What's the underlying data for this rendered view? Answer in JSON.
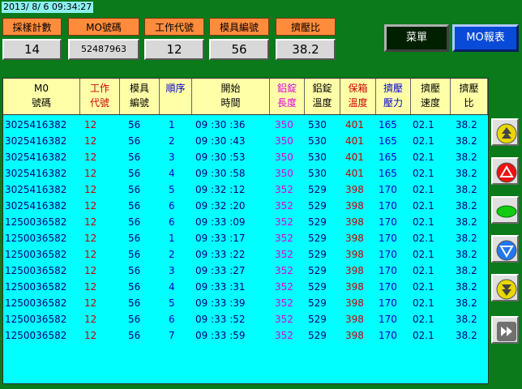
{
  "datetime": "2013/ 8/ 6 09:34:27",
  "stats": [
    {
      "label": "採樣計數",
      "value": "14"
    },
    {
      "label": "MO號碼",
      "value": "52487963"
    },
    {
      "label": "工作代號",
      "value": "12"
    },
    {
      "label": "模具編號",
      "value": "56"
    },
    {
      "label": "擠壓比",
      "value": "38.2"
    }
  ],
  "buttons": {
    "menu": "菜單",
    "mo_report": "MO報表"
  },
  "columns": [
    {
      "line1": "M0",
      "line2": "號碼",
      "color": "#000000"
    },
    {
      "line1": "工作",
      "line2": "代號",
      "color": "#cc0000"
    },
    {
      "line1": "模具",
      "line2": "編號",
      "color": "#000000"
    },
    {
      "line1": "順序",
      "line2": "",
      "color": "#0000cc"
    },
    {
      "line1": "開始",
      "line2": "時間",
      "color": "#000000"
    },
    {
      "line1": "鋁錠",
      "line2": "長度",
      "color": "#dd00dd"
    },
    {
      "line1": "鋁錠",
      "line2": "溫度",
      "color": "#000000"
    },
    {
      "line1": "保箱",
      "line2": "溫度",
      "color": "#cc0000"
    },
    {
      "line1": "擠壓",
      "line2": "壓力",
      "color": "#0000cc"
    },
    {
      "line1": "擠壓",
      "line2": "速度",
      "color": "#000000"
    },
    {
      "line1": "擠壓",
      "line2": "比",
      "color": "#000000"
    }
  ],
  "rows": [
    [
      "3025416382",
      "12",
      "56",
      "1",
      "09 :30 :36",
      "350",
      "530",
      "401",
      "165",
      "02.1",
      "38.2"
    ],
    [
      "3025416382",
      "12",
      "56",
      "2",
      "09 :30 :43",
      "350",
      "530",
      "401",
      "165",
      "02.1",
      "38.2"
    ],
    [
      "3025416382",
      "12",
      "56",
      "3",
      "09 :30 :53",
      "350",
      "530",
      "401",
      "165",
      "02.1",
      "38.2"
    ],
    [
      "3025416382",
      "12",
      "56",
      "4",
      "09 :30 :58",
      "350",
      "530",
      "401",
      "165",
      "02.1",
      "38.2"
    ],
    [
      "3025416382",
      "12",
      "56",
      "5",
      "09 :32 :12",
      "352",
      "529",
      "398",
      "170",
      "02.1",
      "38.2"
    ],
    [
      "3025416382",
      "12",
      "56",
      "6",
      "09 :32 :20",
      "352",
      "529",
      "398",
      "170",
      "02.1",
      "38.2"
    ],
    [
      "1250036582",
      "12",
      "56",
      "6",
      "09 :33 :09",
      "352",
      "529",
      "398",
      "170",
      "02.1",
      "38.2"
    ],
    [
      "1250036582",
      "12",
      "56",
      "1",
      "09 :33 :17",
      "352",
      "529",
      "398",
      "170",
      "02.1",
      "38.2"
    ],
    [
      "1250036582",
      "12",
      "56",
      "2",
      "09 :33 :22",
      "352",
      "529",
      "398",
      "170",
      "02.1",
      "38.2"
    ],
    [
      "1250036582",
      "12",
      "56",
      "3",
      "09 :33 :27",
      "352",
      "529",
      "398",
      "170",
      "02.1",
      "38.2"
    ],
    [
      "1250036582",
      "12",
      "56",
      "4",
      "09 :33 :31",
      "352",
      "529",
      "398",
      "170",
      "02.1",
      "38.2"
    ],
    [
      "1250036582",
      "12",
      "56",
      "5",
      "09 :33 :39",
      "352",
      "529",
      "398",
      "170",
      "02.1",
      "38.2"
    ],
    [
      "1250036582",
      "12",
      "56",
      "6",
      "09 :33 :52",
      "352",
      "529",
      "398",
      "170",
      "02.1",
      "38.2"
    ],
    [
      "1250036582",
      "12",
      "56",
      "7",
      "09 :33 :59",
      "352",
      "529",
      "398",
      "170",
      "02.1",
      "38.2"
    ]
  ],
  "side_buttons": [
    {
      "name": "page-up-icon",
      "color": "#e8d800"
    },
    {
      "name": "scroll-up-icon",
      "color": "#ee1111"
    },
    {
      "name": "stop-icon",
      "color": "#11cc11"
    },
    {
      "name": "scroll-down-icon",
      "color": "#2277ee"
    },
    {
      "name": "page-down-icon",
      "color": "#e8d800"
    },
    {
      "name": "fast-forward-icon",
      "color": "#707070"
    }
  ]
}
